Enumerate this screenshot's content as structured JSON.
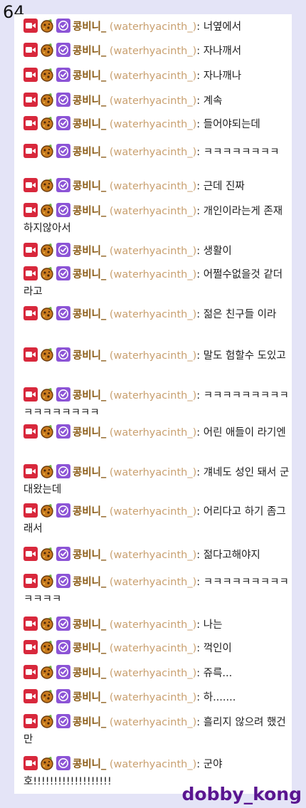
{
  "page_number": "64",
  "watermark": "dobby_kong",
  "user": {
    "nickname": "콩비니_",
    "login": "(waterhyacinth_)",
    "separator": ":"
  },
  "badges": [
    "video-camera-icon",
    "cookie-icon",
    "verified-check-icon"
  ],
  "colors": {
    "background": "#e4e4f7",
    "panel": "#ffffff",
    "nickname": "#8a5a14",
    "login": "#c9a070",
    "watermark": "#5a1590",
    "camera_badge": "#d8283c",
    "verified_badge": "#8c54d6"
  },
  "messages": [
    "너옆에서",
    "자나깨서",
    "자나깨나",
    "계속",
    "들어야되는데",
    "ㅋㅋㅋㅋㅋㅋㅋㅋ",
    "근데 진짜",
    "개인이라는게 존재하지않아서",
    "생활이",
    "어쩔수없을것 같더라고",
    "젊은 친구들 이라",
    "말도 험할수 도있고",
    "ㅋㅋㅋㅋㅋㅋㅋㅋㅋㅋㅋㅋㅋㅋㅋㅋㅋ",
    "어린 애들이 라기엔",
    "걔네도 성인 돼서 군대왔는데",
    "어리다고 하기 좀그래서",
    "젊다고해야지",
    "ㅋㅋㅋㅋㅋㅋㅋㅋㅋㅋㅋㅋㅋ",
    "나는",
    "꺽인이",
    "쥬륵...",
    "하.......",
    "흘리지 않으려 했건만",
    "군야 호!!!!!!!!!!!!!!!!!!!"
  ]
}
